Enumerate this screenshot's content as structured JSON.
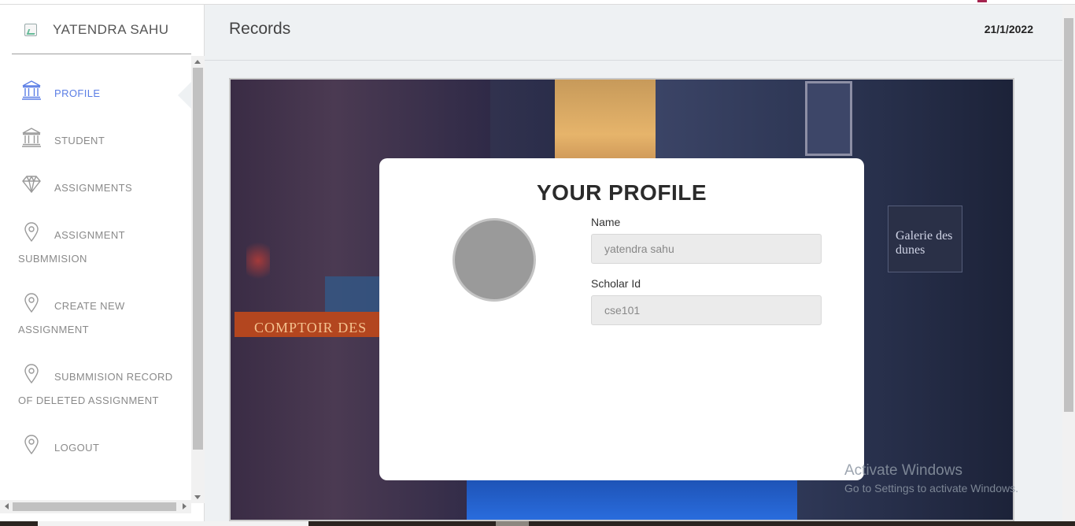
{
  "brand": {
    "name": "YATENDRA SAHU"
  },
  "sidebar": {
    "items": [
      {
        "label": "PROFILE",
        "icon": "bank-icon",
        "active": true
      },
      {
        "label": "STUDENT",
        "icon": "bank-icon",
        "active": false
      },
      {
        "label": "ASSIGNMENTS",
        "icon": "diamond-icon",
        "active": false
      },
      {
        "label": "ASSIGNMENT SUBMMISION",
        "icon": "map-pin-icon",
        "active": false
      },
      {
        "label": "CREATE NEW ASSIGNMENT",
        "icon": "map-pin-icon",
        "active": false
      },
      {
        "label": "SUBMMISION RECORD OF DELETED ASSIGNMENT",
        "icon": "map-pin-icon",
        "active": false
      },
      {
        "label": "LOGOUT",
        "icon": "map-pin-icon",
        "active": false
      }
    ]
  },
  "header": {
    "title": "Records",
    "date": "21/1/2022"
  },
  "profile": {
    "title": "YOUR PROFILE",
    "name_label": "Name",
    "name_value": "yatendra sahu",
    "scholar_label": "Scholar Id",
    "scholar_value": "cse101"
  },
  "hero_signs": {
    "shop": "COMPTOIR DES",
    "gallery": "Galerie des dunes"
  },
  "watermark": {
    "line1": "Activate Windows",
    "line2": "Go to Settings to activate Windows."
  },
  "colors": {
    "accent": "#5b7ee5",
    "muted_nav": "#8a8a8a",
    "background": "#eef1f3"
  }
}
